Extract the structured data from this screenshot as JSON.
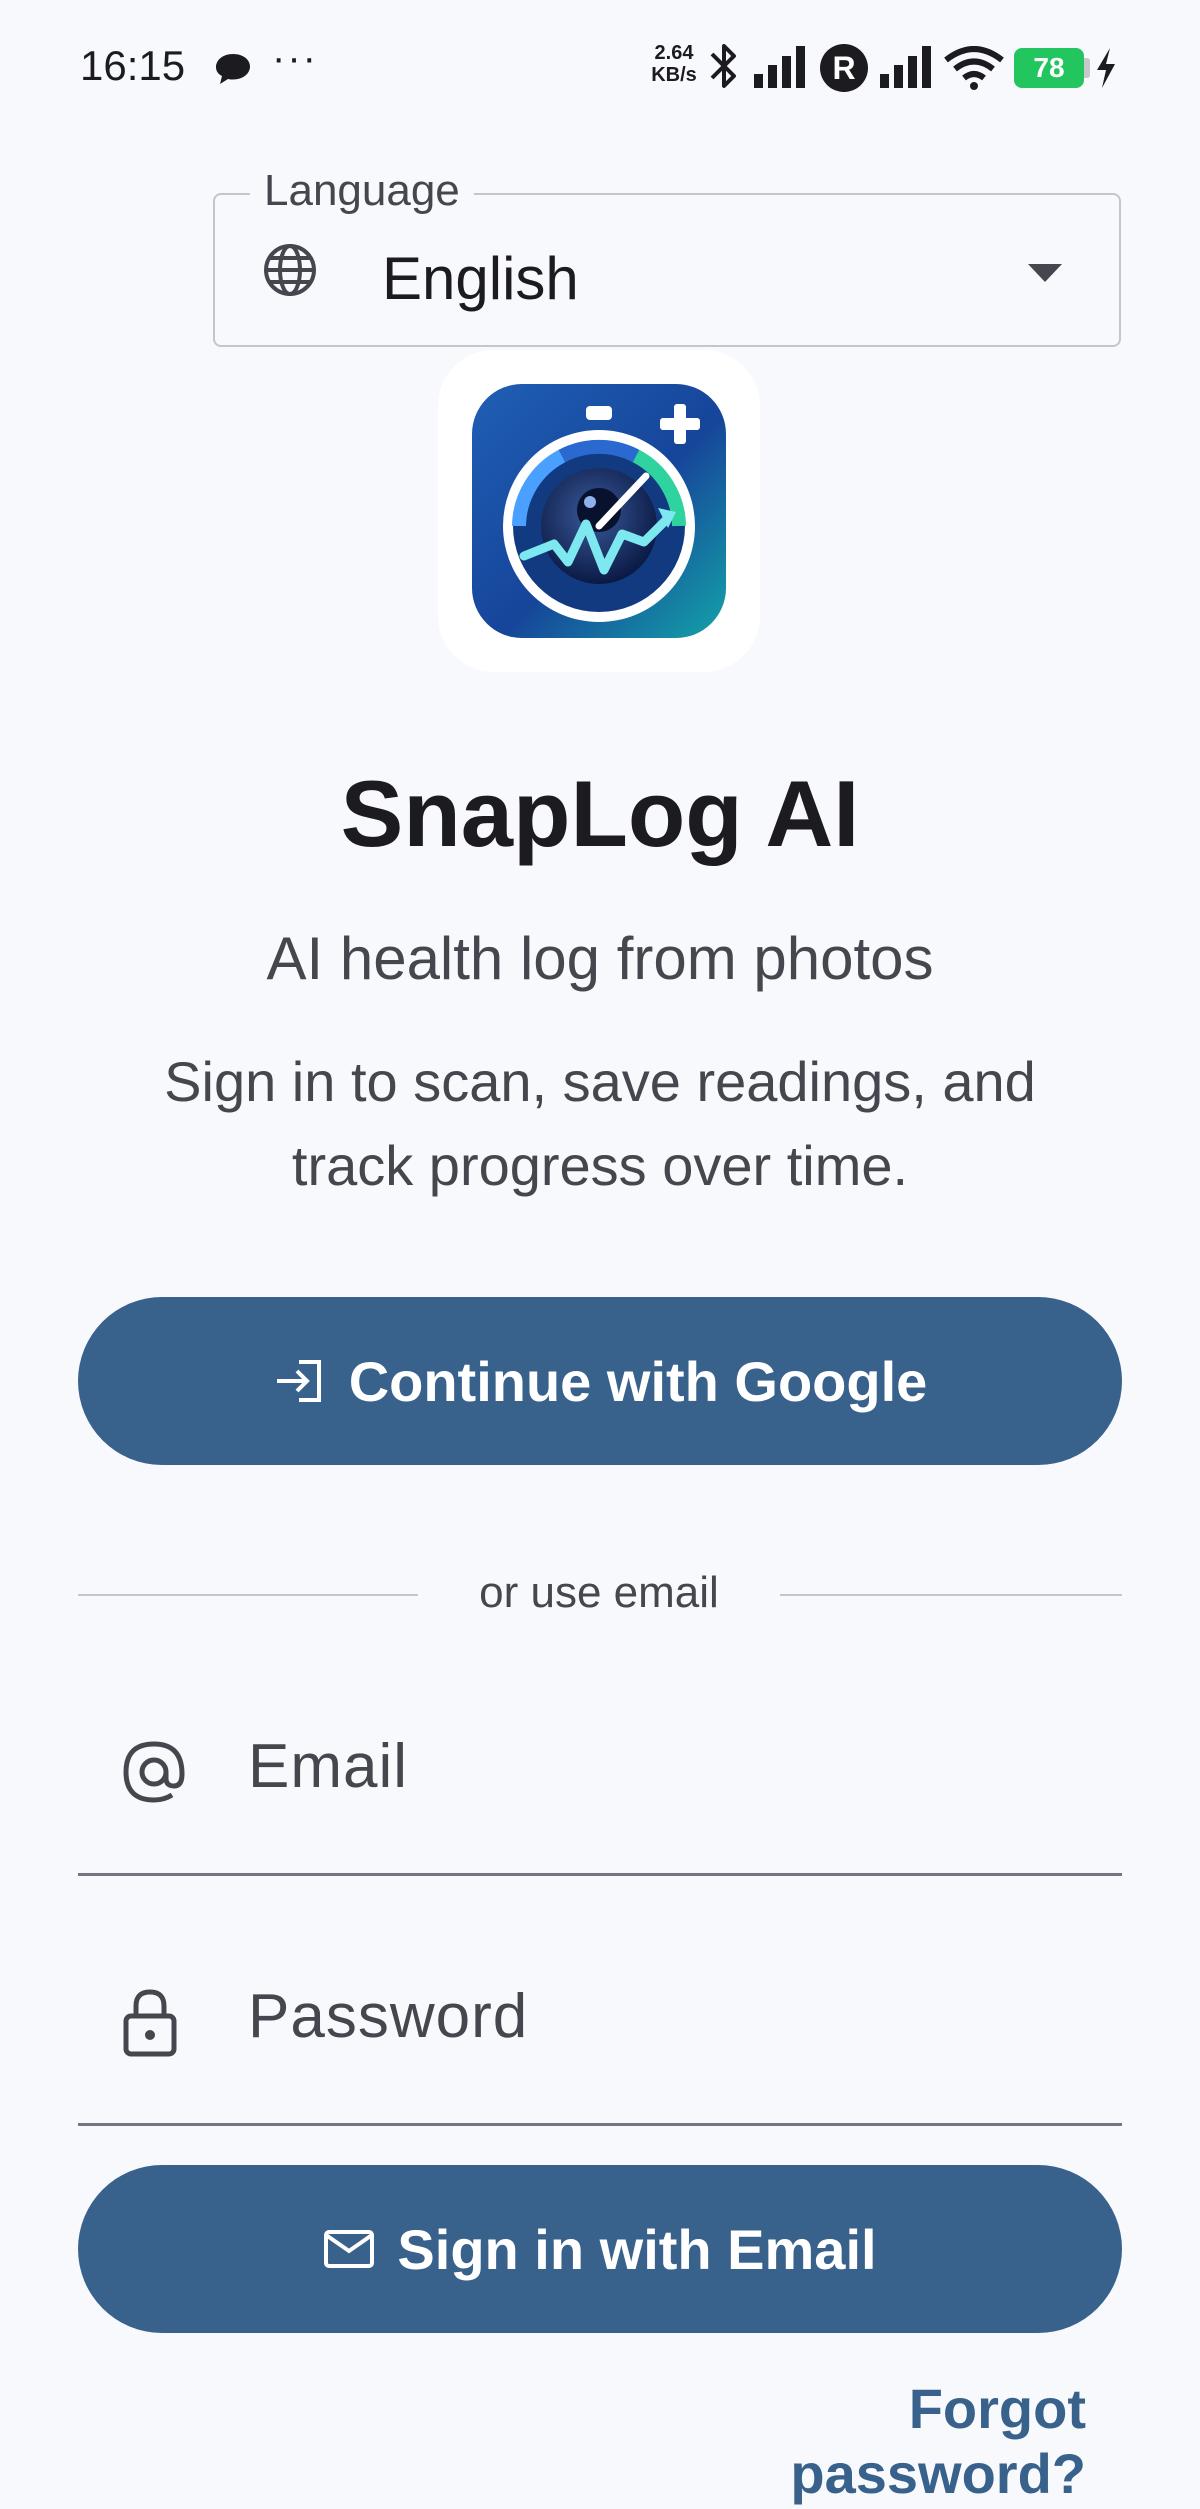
{
  "status_bar": {
    "time": "16:15",
    "dots": "···",
    "net_speed_value": "2.64",
    "net_speed_unit": "KB/s",
    "carrier_badge": "R",
    "battery_level": "78"
  },
  "language": {
    "label": "Language",
    "selected": "English"
  },
  "app": {
    "title": "SnapLog AI",
    "tagline": "AI health log from photos",
    "description": "Sign in to scan, save readings, and track progress over time."
  },
  "google_button": {
    "label": "Continue with Google"
  },
  "divider": {
    "text": "or use email"
  },
  "email_field": {
    "placeholder": "Email",
    "value": ""
  },
  "password_field": {
    "placeholder": "Password",
    "value": ""
  },
  "email_button": {
    "label": "Sign in with Email"
  },
  "forgot_link": {
    "label": "Forgot password?"
  },
  "colors": {
    "primary": "#38618c",
    "background": "#f8f9fd",
    "battery": "#22c55e",
    "text": "#1c1b1f",
    "secondary_text": "#44474e"
  }
}
